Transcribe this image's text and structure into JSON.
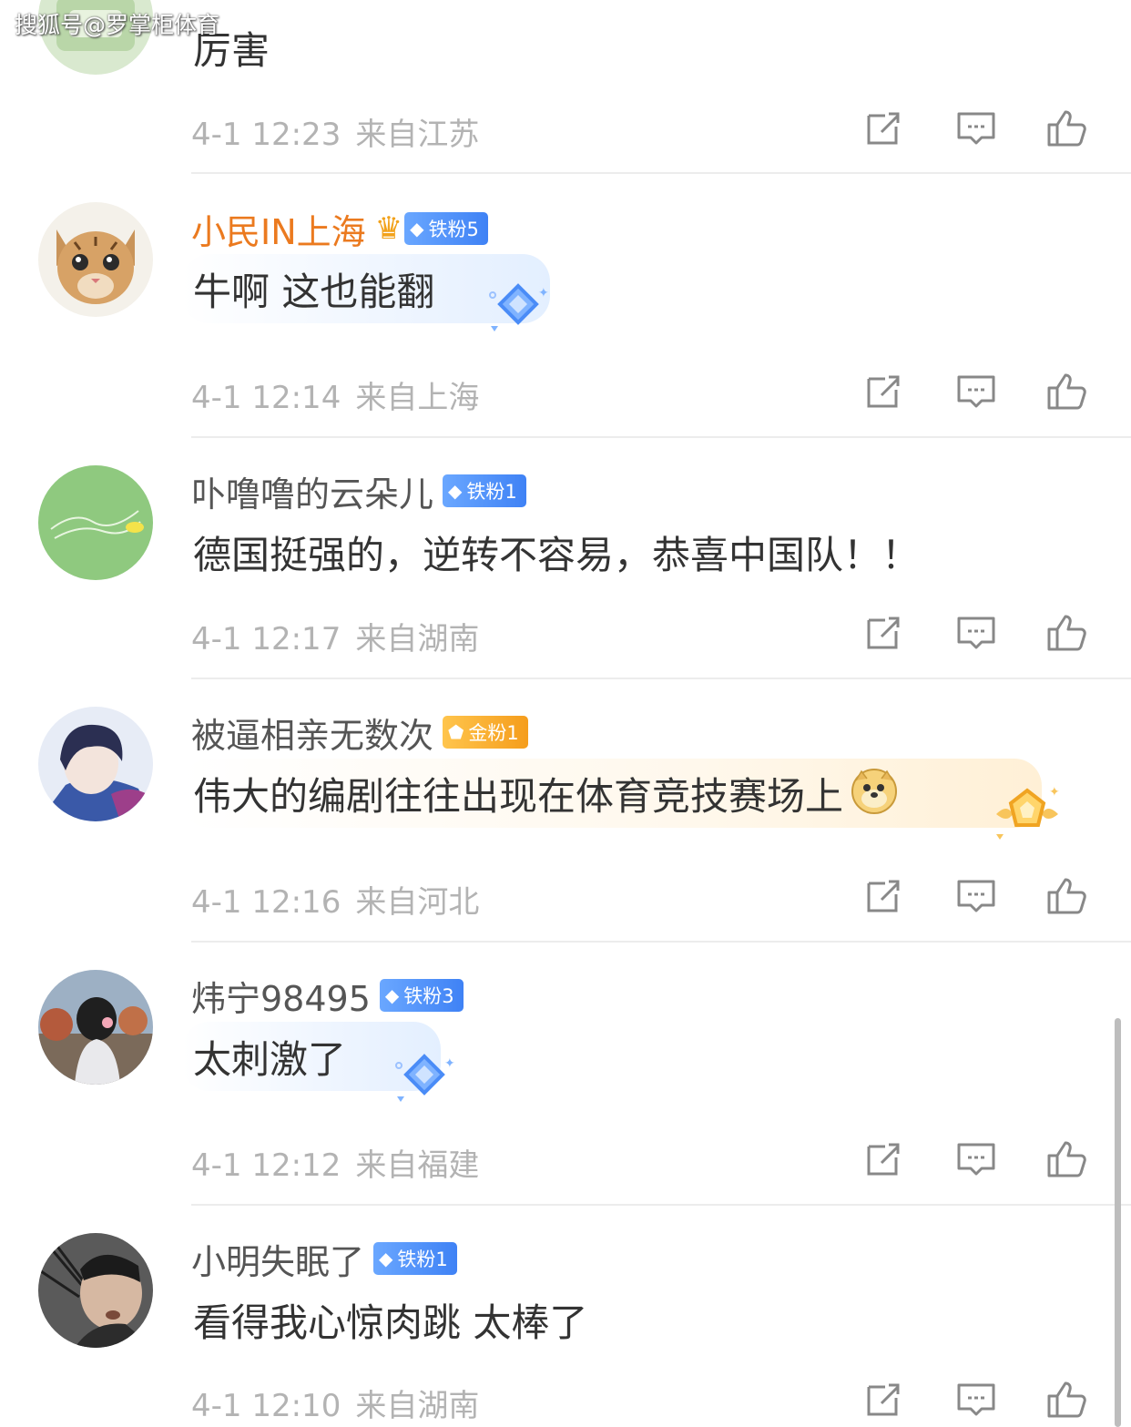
{
  "watermark": "搜狐号@罗掌柜体育",
  "comments": [
    {
      "username": "",
      "text": "厉害",
      "time": "4-1 12:23",
      "location": "来自江苏"
    },
    {
      "username": "小民IN上海",
      "badge": "铁粉5",
      "text": "牛啊 这也能翻",
      "time": "4-1 12:14",
      "location": "来自上海"
    },
    {
      "username": "卟噜噜的云朵儿",
      "badge": "铁粉1",
      "text": "德国挺强的，逆转不容易，恭喜中国队！！",
      "time": "4-1 12:17",
      "location": "来自湖南"
    },
    {
      "username": "被逼相亲无数次",
      "badge": "金粉1",
      "text": "伟大的编剧往往出现在体育竞技赛场上",
      "time": "4-1 12:16",
      "location": "来自河北"
    },
    {
      "username": "炜宁98495",
      "badge": "铁粉3",
      "text": "太刺激了",
      "time": "4-1 12:12",
      "location": "来自福建"
    },
    {
      "username": "小明失眠了",
      "badge": "铁粉1",
      "text": "看得我心惊肉跳 太棒了",
      "time": "4-1 12:10",
      "location": "来自湖南"
    }
  ],
  "colors": {
    "vip_name": "#eb7a1f",
    "iron_badge": "#4a8cf7",
    "gold_badge": "#f7a928",
    "meta": "#b3b3b3"
  },
  "icons": [
    "share-icon",
    "reply-icon",
    "like-icon",
    "doge-emoji"
  ]
}
